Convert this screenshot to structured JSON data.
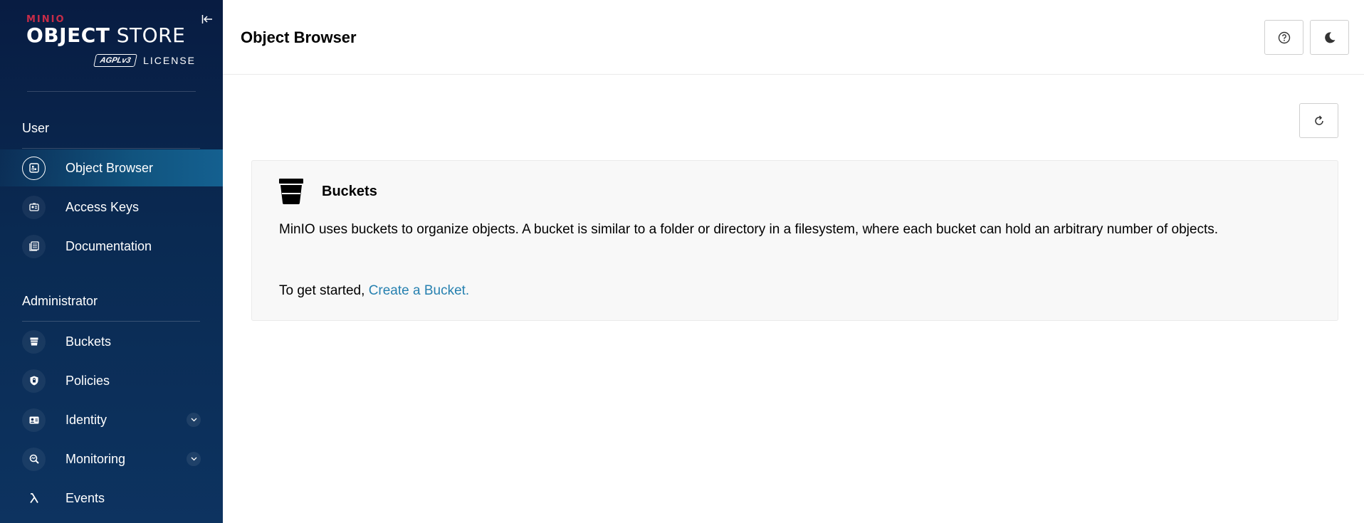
{
  "sidebar": {
    "logo": {
      "brand": "MINIO",
      "product_bold": "OBJECT",
      "product_light": " STORE",
      "badge": "AGPLv3",
      "license": "LICENSE"
    },
    "sections": [
      {
        "title": "User",
        "items": [
          {
            "label": "Object Browser",
            "icon": "object-browser-icon",
            "active": true
          },
          {
            "label": "Access Keys",
            "icon": "access-keys-icon"
          },
          {
            "label": "Documentation",
            "icon": "documentation-icon"
          }
        ]
      },
      {
        "title": "Administrator",
        "items": [
          {
            "label": "Buckets",
            "icon": "bucket-icon"
          },
          {
            "label": "Policies",
            "icon": "policy-shield-icon"
          },
          {
            "label": "Identity",
            "icon": "identity-card-icon",
            "expandable": true
          },
          {
            "label": "Monitoring",
            "icon": "monitoring-search-icon",
            "expandable": true
          },
          {
            "label": "Events",
            "icon": "lambda-icon"
          }
        ]
      }
    ]
  },
  "header": {
    "title": "Object Browser",
    "help_icon": "help-circle-icon",
    "theme_icon": "moon-icon"
  },
  "main": {
    "refresh_icon": "refresh-icon",
    "info": {
      "title": "Buckets",
      "description": "MinIO uses buckets to organize objects. A bucket is similar to a folder or directory in a filesystem, where each bucket can hold an arbitrary number of objects.",
      "cta_prefix": "To get started, ",
      "cta_link": "Create a Bucket."
    }
  },
  "colors": {
    "sidebar_bg": "#081c42",
    "active_item": "#146090",
    "link": "#2781b0",
    "brand_red": "#c72c48"
  }
}
